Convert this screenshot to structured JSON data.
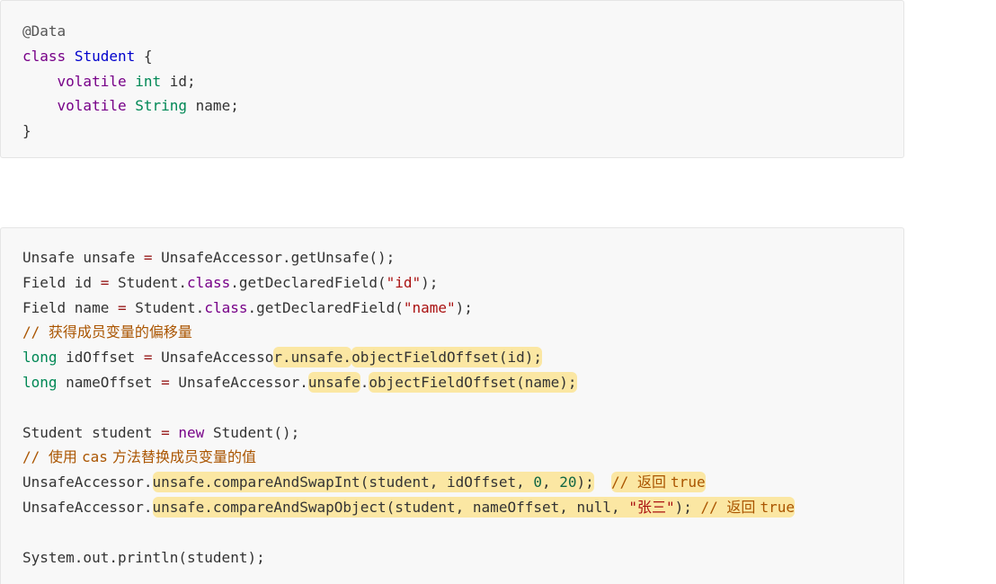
{
  "block1": {
    "lines": [
      {
        "t1": "@Data"
      },
      {
        "t1": "class",
        "t2": " ",
        "t3": "Student",
        "t4": " {"
      },
      {
        "t1": "    ",
        "t2": "volatile",
        "t3": " ",
        "t4": "int",
        "t5": " id;"
      },
      {
        "t1": "    ",
        "t2": "volatile",
        "t3": " ",
        "t4": "String",
        "t5": " name;"
      },
      {
        "t1": "}"
      }
    ]
  },
  "block2": {
    "l1": {
      "a": "Unsafe unsafe ",
      "op": "=",
      "b": " UnsafeAccessor.getUnsafe();"
    },
    "l2": {
      "a": "Field id ",
      "op": "=",
      "b": " Student.",
      "kw": "class",
      "c": ".getDeclaredField(",
      "str": "\"id\"",
      "d": ");"
    },
    "l3": {
      "a": "Field name ",
      "op": "=",
      "b": " Student.",
      "kw": "class",
      "c": ".getDeclaredField(",
      "str": "\"name\"",
      "d": ");"
    },
    "l4": {
      "slash": "// ",
      "text": "获得成员变量的偏移量"
    },
    "l5": {
      "ty": "long",
      "a": " idOffset ",
      "op": "=",
      "b": " UnsafeAccesso",
      "h1": "r.unsafe.",
      "h2": "objectFieldOffset(id);"
    },
    "l6": {
      "ty": "long",
      "a": " nameOffset ",
      "op": "=",
      "b": " UnsafeAccessor.",
      "h1": "unsafe",
      "dot": ".",
      "h2": "objectFieldOffset(name);"
    },
    "l7": {
      "a": "Student student ",
      "op": "=",
      "b": " ",
      "kw": "new",
      "c": " Student();"
    },
    "l8": {
      "slash": "// ",
      "t1": "使用 ",
      "ascii": "cas",
      "t2": " 方法替换成员变量的值"
    },
    "l9": {
      "a": "UnsafeAccessor.",
      "h1a": "unsafe.compareAndSwapInt(student, idOffset, ",
      "n1": "0",
      "h1b": ", ",
      "n2": "20",
      "h1c": ");",
      "gap": "  ",
      "cm_slash": "// ",
      "cm_text": "返回 ",
      "cm_ascii": "true"
    },
    "l10": {
      "a": "UnsafeAccessor.",
      "h1a": "unsafe.compareAndSwapObject(student, nameOffset, null, ",
      "str": "\"张三\"",
      "h1b": "); ",
      "cm_slash": "// ",
      "cm_text": "返回 ",
      "cm_ascii": "true"
    },
    "l11": {
      "a": "System.out.println(student);"
    }
  }
}
